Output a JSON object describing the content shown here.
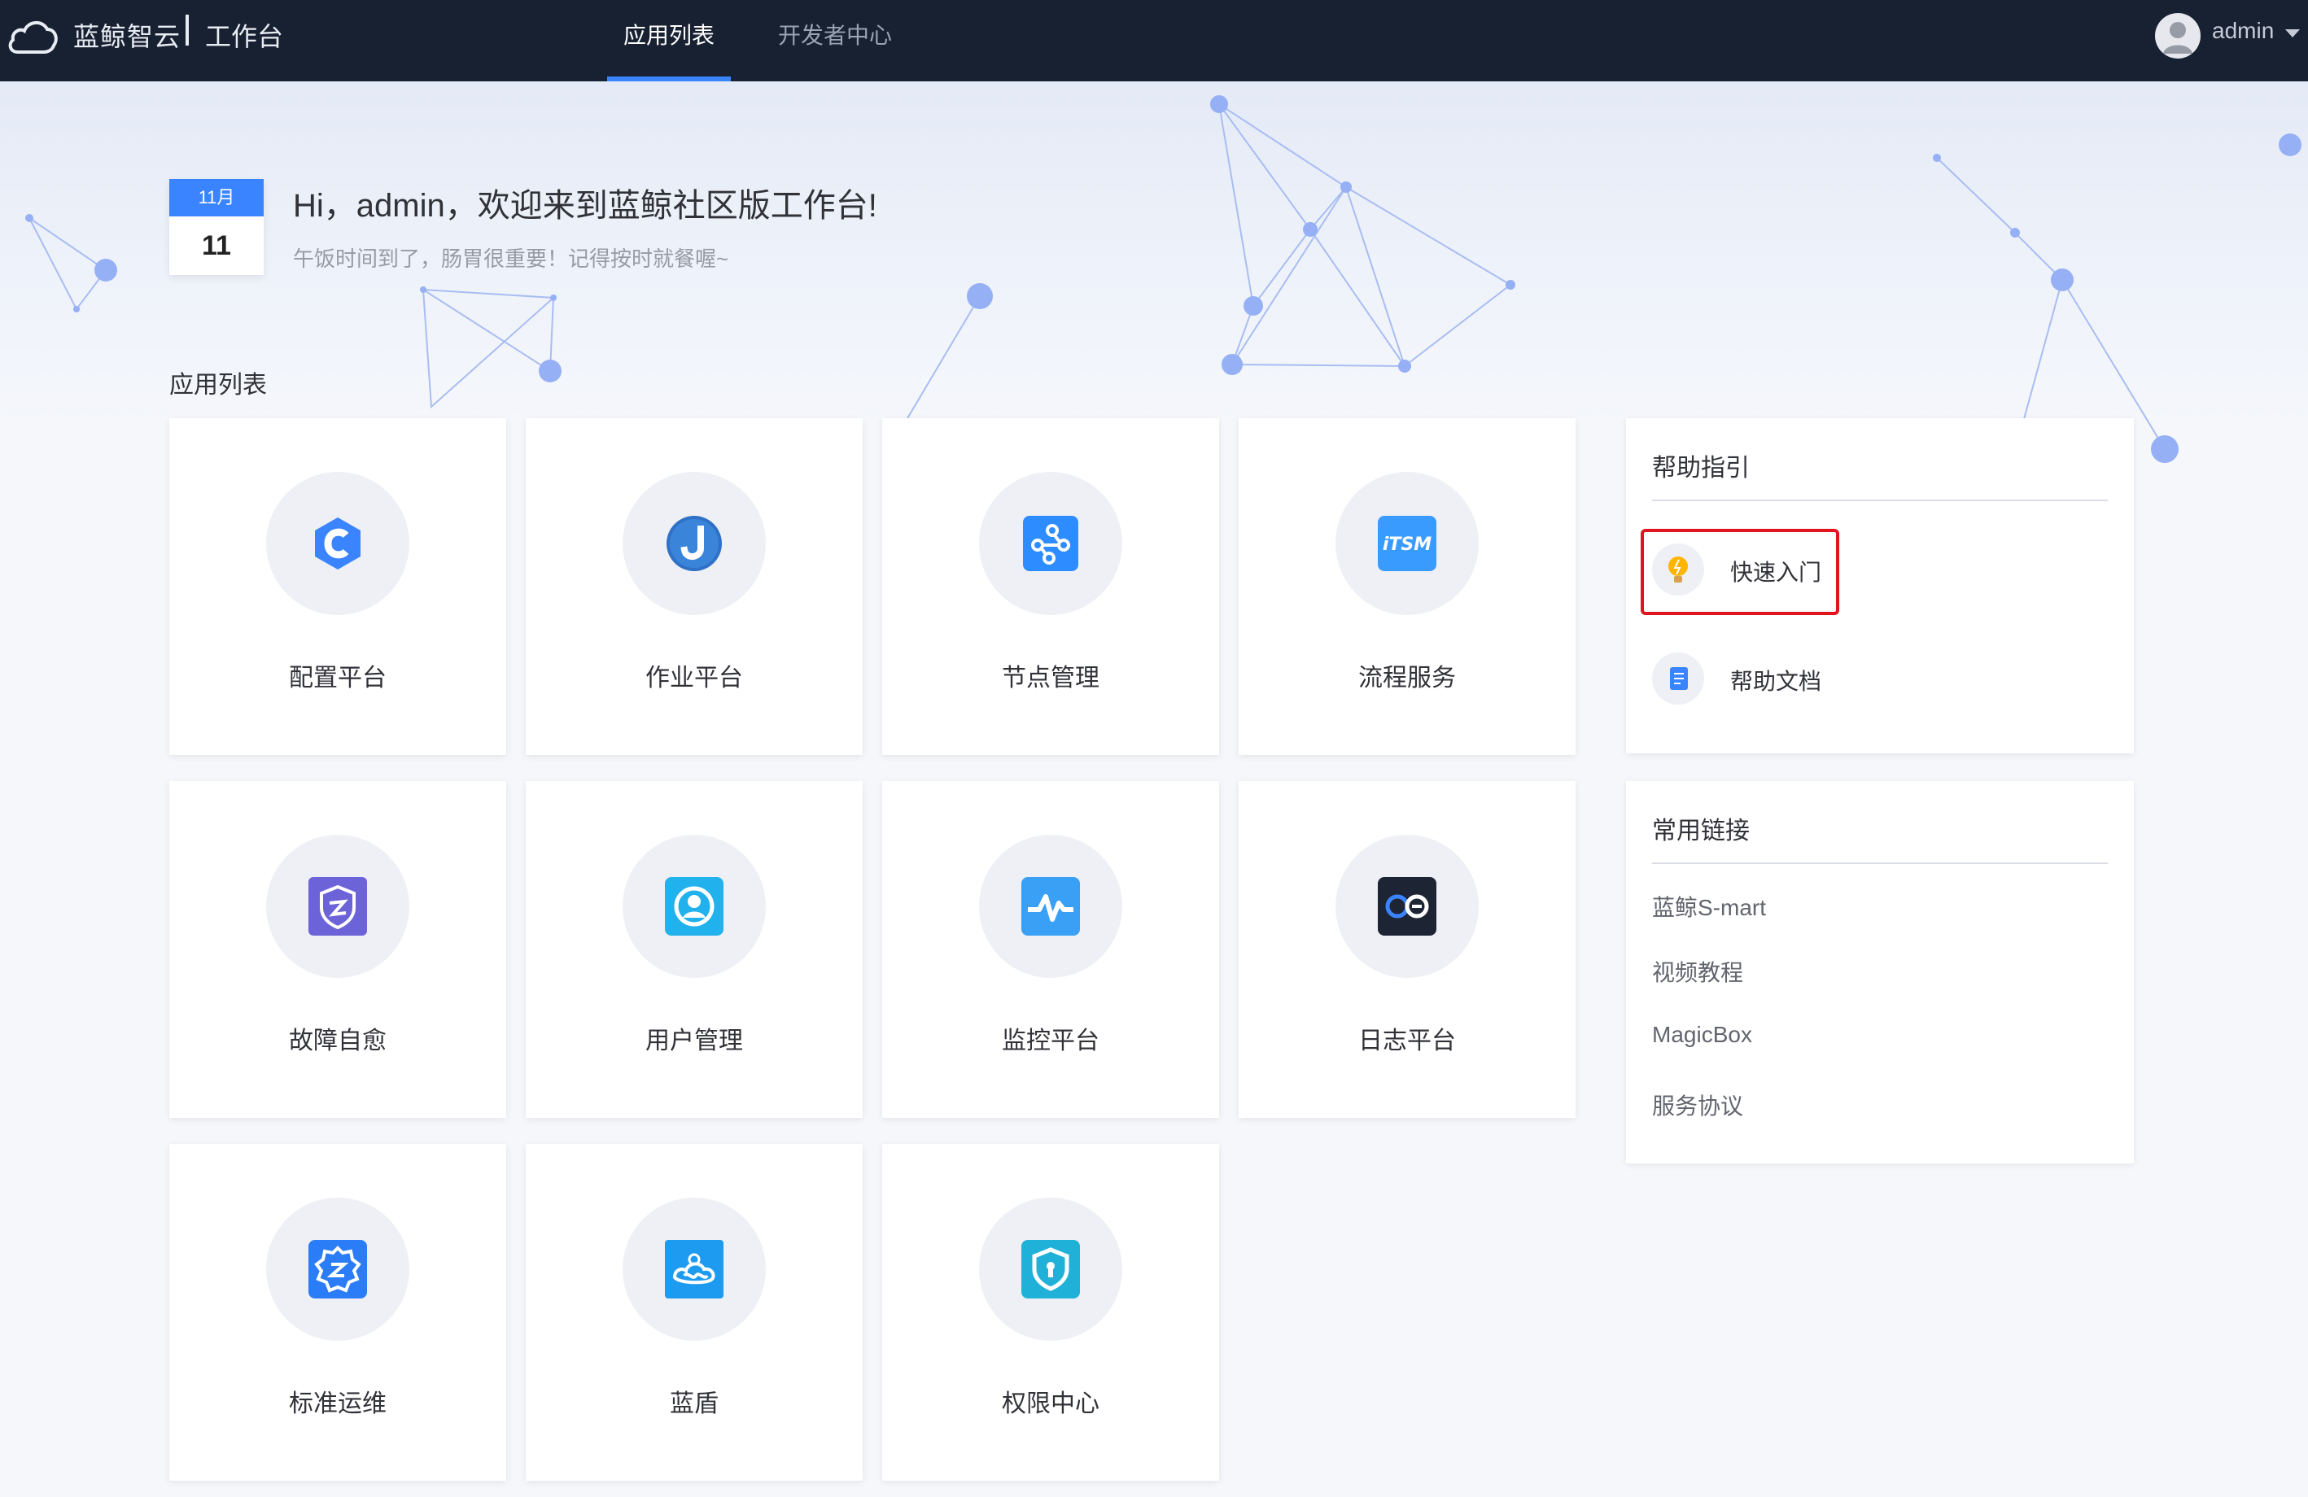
{
  "header": {
    "brand": "蓝鲸智云",
    "product": "工作台",
    "nav": [
      {
        "label": "应用列表",
        "active": true
      },
      {
        "label": "开发者中心",
        "active": false
      }
    ],
    "user": "admin",
    "accent": "#3a84ff",
    "bg": "#182132"
  },
  "welcome": {
    "month": "11月",
    "day": "11",
    "greeting": "Hi，admin，欢迎来到蓝鲸社区版工作台!",
    "tip": "午饭时间到了，肠胃很重要！记得按时就餐喔~"
  },
  "apps_title": "应用列表",
  "apps": [
    {
      "label": "配置平台",
      "icon": "cmdb-icon"
    },
    {
      "label": "作业平台",
      "icon": "job-icon"
    },
    {
      "label": "节点管理",
      "icon": "node-icon"
    },
    {
      "label": "流程服务",
      "icon": "itsm-icon"
    },
    {
      "label": "故障自愈",
      "icon": "fta-icon"
    },
    {
      "label": "用户管理",
      "icon": "user-icon"
    },
    {
      "label": "监控平台",
      "icon": "monitor-icon"
    },
    {
      "label": "日志平台",
      "icon": "log-icon"
    },
    {
      "label": "标准运维",
      "icon": "sops-icon"
    },
    {
      "label": "蓝盾",
      "icon": "devops-icon"
    },
    {
      "label": "权限中心",
      "icon": "iam-icon"
    }
  ],
  "help": {
    "title": "帮助指引",
    "items": [
      {
        "label": "快速入门",
        "icon": "lightbulb-icon"
      },
      {
        "label": "帮助文档",
        "icon": "document-icon"
      }
    ]
  },
  "links": {
    "title": "常用链接",
    "items": [
      "蓝鲸S-mart",
      "视频教程",
      "MagicBox",
      "服务协议"
    ]
  }
}
